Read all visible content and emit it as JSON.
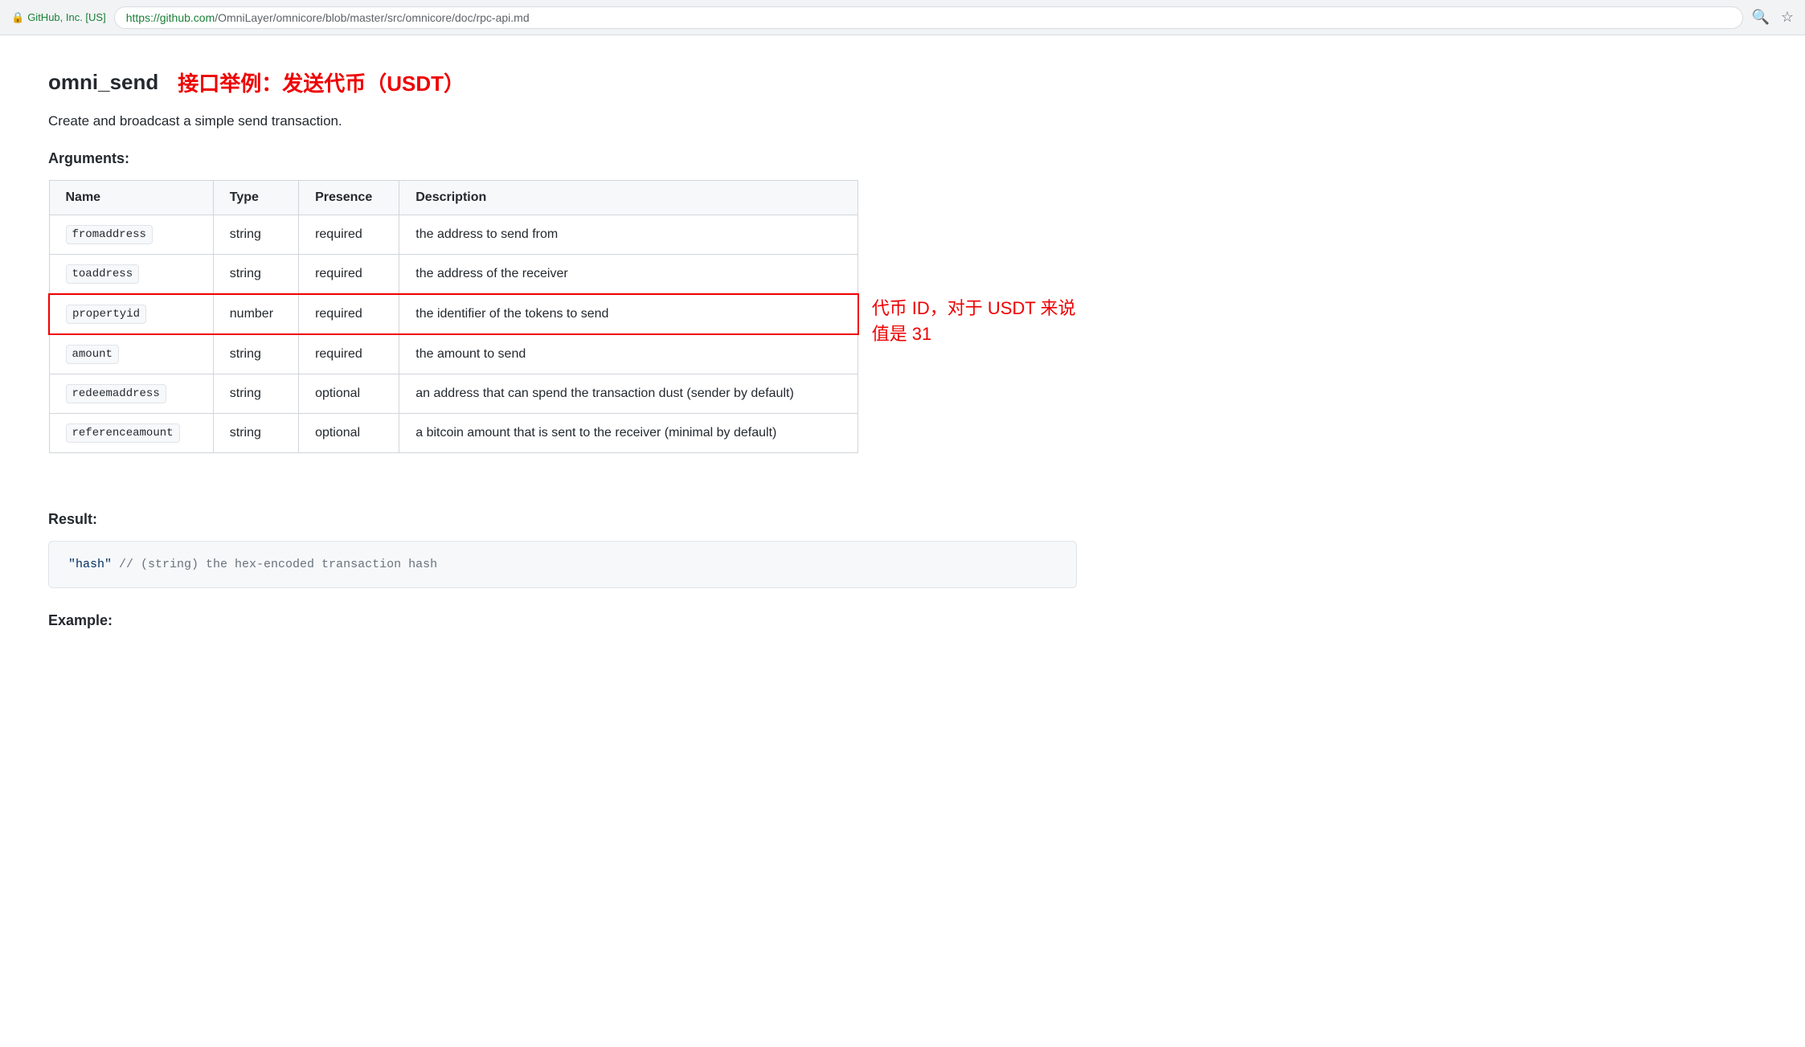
{
  "browser": {
    "lock_label": "GitHub, Inc. [US]",
    "url_green": "https://github.com",
    "url_normal": "/OmniLayer/omnicore/blob/master/src/omnicore/doc/rpc-api.md",
    "search_icon": "🔍",
    "star_icon": "☆"
  },
  "page": {
    "title": "omni_send",
    "subtitle": "接口举例：发送代币（USDT）",
    "description": "Create and broadcast a simple send transaction.",
    "arguments_heading": "Arguments:",
    "result_heading": "Result:",
    "example_heading": "Example:",
    "table": {
      "headers": [
        "Name",
        "Type",
        "Presence",
        "Description"
      ],
      "rows": [
        {
          "name": "fromaddress",
          "type": "string",
          "presence": "required",
          "description": "the address to send from",
          "highlighted": false
        },
        {
          "name": "toaddress",
          "type": "string",
          "presence": "required",
          "description": "the address of the receiver",
          "highlighted": false
        },
        {
          "name": "propertyid",
          "type": "number",
          "presence": "required",
          "description": "the identifier of the tokens to send",
          "highlighted": true,
          "annotation": "代币 ID，对于 USDT 来说值是 31"
        },
        {
          "name": "amount",
          "type": "string",
          "presence": "required",
          "description": "the amount to send",
          "highlighted": false
        },
        {
          "name": "redeemaddress",
          "type": "string",
          "presence": "optional",
          "description": "an address that can spend the transaction dust (sender by default)",
          "highlighted": false
        },
        {
          "name": "referenceamount",
          "type": "string",
          "presence": "optional",
          "description": "a bitcoin amount that is sent to the receiver (minimal by default)",
          "highlighted": false
        }
      ]
    },
    "result_code": "\"hash\"  // (string) the hex-encoded transaction hash"
  }
}
